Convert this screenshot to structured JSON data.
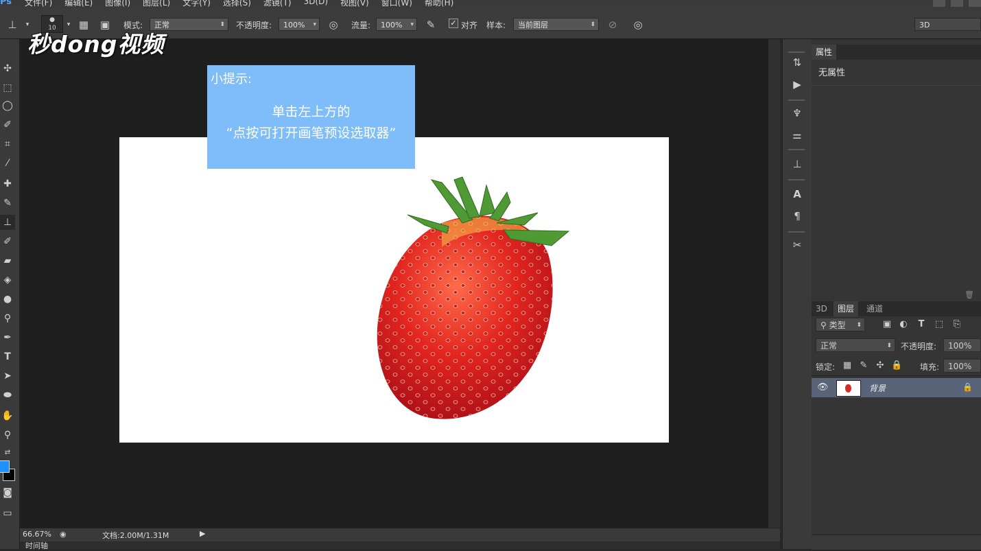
{
  "app": {
    "logo": "Ps"
  },
  "menu": [
    "文件(F)",
    "编辑(E)",
    "图像(I)",
    "图层(L)",
    "文字(Y)",
    "选择(S)",
    "滤镜(T)",
    "3D(D)",
    "视图(V)",
    "窗口(W)",
    "帮助(H)"
  ],
  "options": {
    "brush_size": "10",
    "mode_label": "模式:",
    "mode_value": "正常",
    "opacity_label": "不透明度:",
    "opacity_value": "100%",
    "flow_label": "流量:",
    "flow_value": "100%",
    "align_label": "对齐",
    "align_checked": "✓",
    "sample_label": "样本:",
    "sample_value": "当前图层",
    "workspace_value": "3D"
  },
  "watermark": "秒dong视频",
  "tip": {
    "title": "小提示:",
    "line1": "单击左上方的",
    "line2": "“点按可打开画笔预设选取器”"
  },
  "status": {
    "zoom": "66.67%",
    "doc_info": "文档:2.00M/1.31M",
    "timeline_label": "时间轴"
  },
  "properties": {
    "tab_label": "属性",
    "empty_text": "无属性"
  },
  "layers_panel": {
    "tabs": [
      "3D",
      "图层",
      "通道"
    ],
    "active_tab": "图层",
    "filter_label": "类型",
    "blend_mode": "正常",
    "opacity_label": "不透明度:",
    "opacity_value": "100%",
    "lock_label": "锁定:",
    "fill_label": "填充:",
    "fill_value": "100%",
    "layers": [
      {
        "name": "背景",
        "visible": true,
        "locked": true
      }
    ]
  },
  "colors": {
    "foreground": "#1e8fff",
    "background": "#000000",
    "tip_box": "#7ebdfa",
    "selected_layer": "#5a6478"
  }
}
